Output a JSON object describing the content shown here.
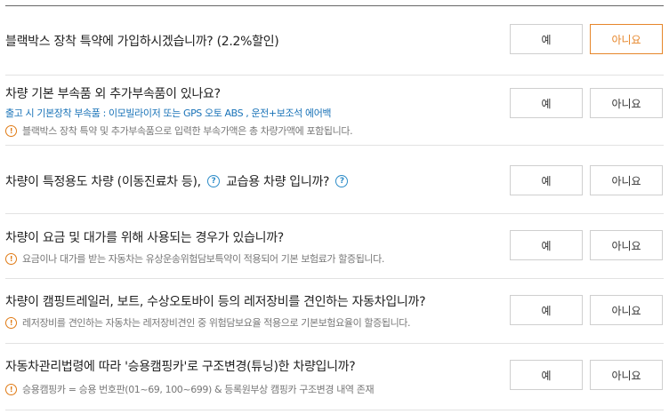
{
  "questions": [
    {
      "text": "블랙박스 장착 특약에 가입하시겠습니까? (2.2%할인)",
      "yes": "예",
      "no": "아니요",
      "selected": "no"
    },
    {
      "text": "차량 기본 부속품 외 추가부속품이 있나요?",
      "sub": "출고 시 기본장착 부속품 : 이모빌라이저 또는 GPS 오토 ABS , 운전+보조석 에어백",
      "note": "블랙박스 장착 특약 및 추가부속품으로 입력한 부속가액은 총 차량가액에 포함됩니다.",
      "yes": "예",
      "no": "아니요"
    },
    {
      "text_part1": "차량이 특정용도 차량 (이동진료차 등),",
      "text_part2": "교습용 차량 입니까?",
      "help_glyph": "?",
      "yes": "예",
      "no": "아니요"
    },
    {
      "text": "차량이 요금 및 대가를 위해 사용되는 경우가 있습니까?",
      "note": "요금이나 대가를 받는 자동차는 유상운송위험담보특약이 적용되어 기본 보험료가 할증됩니다.",
      "yes": "예",
      "no": "아니요"
    },
    {
      "text": "차량이 캠핑트레일러, 보트, 수상오토바이 등의 레저장비를 견인하는 자동차입니까?",
      "note": "레저장비를 견인하는 자동차는 레저장비견인 중 위험담보요율 적용으로 기본보험요율이 할증됩니다.",
      "yes": "예",
      "no": "아니요"
    },
    {
      "text": "자동차관리법령에 따라 '승용캠핑카'로 구조변경(튜닝)한 차량입니까?",
      "note": "승용캠핑카 = 승용 번호판(01~69, 100~699) & 등록원부상 캠핑카 구조변경 내역 존재",
      "yes": "예",
      "no": "아니요"
    }
  ],
  "note_icon_glyph": "!",
  "colors": {
    "accent_orange": "#e6862a",
    "link_blue": "#1a73b8",
    "note_gray": "#777777",
    "divider": "#e2e2e2"
  },
  "icons": {
    "note": "exclamation-circle-icon",
    "help": "question-circle-icon"
  }
}
